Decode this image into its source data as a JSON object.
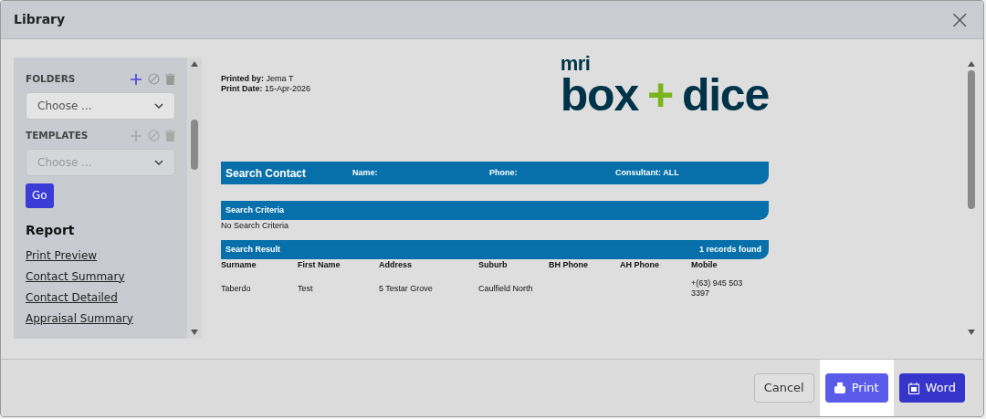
{
  "window": {
    "title": "Library",
    "close": "×"
  },
  "sidebar": {
    "sections": [
      {
        "label": "FOLDERS",
        "disabled": false,
        "select": {
          "placeholder": "Choose ..."
        }
      },
      {
        "label": "TEMPLATES",
        "disabled": true,
        "select": {
          "placeholder": "Choose ..."
        }
      }
    ],
    "go_button": "Go",
    "report_heading": "Report",
    "links": [
      "Print Preview",
      "Contact Summary",
      "Contact Detailed",
      "Appraisal Summary"
    ]
  },
  "preview": {
    "printed_by_label": "Printed by:",
    "printed_by": "Jema T",
    "print_date_label": "Print Date:",
    "print_date": "15-Apr-2026",
    "logo": {
      "small": "mri",
      "main_left": "box",
      "plus": "+",
      "main_right": "dice"
    },
    "search_bar": {
      "title": "Search Contact",
      "fields": [
        "Name:",
        "Phone:",
        "Consultant: ALL"
      ]
    },
    "criteria": {
      "title": "Search Criteria",
      "text": "No Search Criteria"
    },
    "result": {
      "title": "Search Result",
      "count": "1 records found",
      "columns": [
        "Surname",
        "First Name",
        "Address",
        "Suburb",
        "BH Phone",
        "AH Phone",
        "Mobile"
      ],
      "rows": [
        [
          "Taberdo",
          "Test",
          "5 Testar Grove",
          "Caulfield North",
          "",
          "",
          "+(63)  945 503 3397"
        ]
      ]
    }
  },
  "footer": {
    "buttons": [
      {
        "kind": "cancel",
        "label": "Cancel",
        "highlighted": false
      },
      {
        "kind": "print",
        "label": "Print",
        "highlighted": true
      },
      {
        "kind": "word",
        "label": "Word",
        "highlighted": false
      }
    ]
  }
}
